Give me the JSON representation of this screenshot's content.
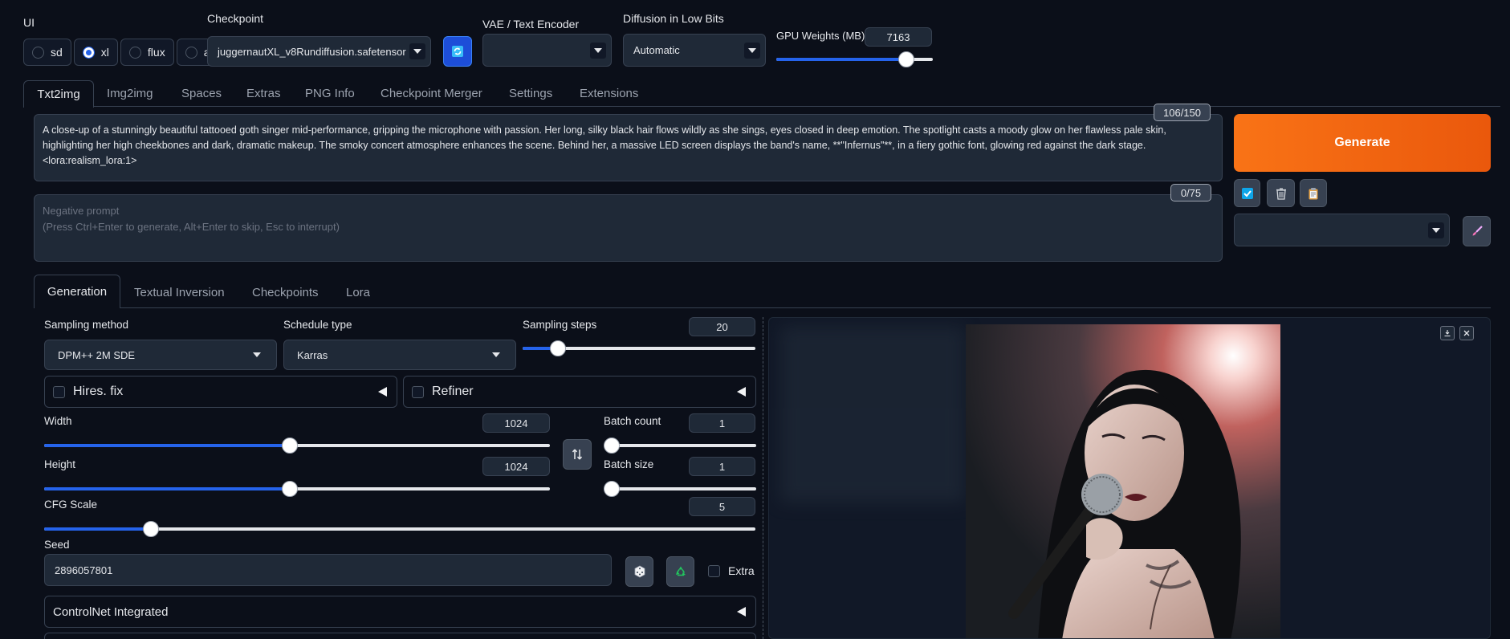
{
  "top": {
    "ui_label": "UI",
    "ui_options": [
      "sd",
      "xl",
      "flux",
      "all"
    ],
    "ui_selected": "xl",
    "checkpoint_label": "Checkpoint",
    "checkpoint_value": "juggernautXL_v8Rundiffusion.safetensor",
    "vae_label": "VAE / Text Encoder",
    "vae_value": "",
    "diffusion_label": "Diffusion in Low Bits",
    "diffusion_value": "Automatic",
    "gpu_label": "GPU Weights (MB)",
    "gpu_value": "7163",
    "gpu_slider_fraction": 0.83
  },
  "tabs": [
    "Txt2img",
    "Img2img",
    "Spaces",
    "Extras",
    "PNG Info",
    "Checkpoint Merger",
    "Settings",
    "Extensions"
  ],
  "prompt": {
    "text": "A close-up of a stunningly beautiful tattooed goth singer mid-performance, gripping the microphone with passion. Her long, silky black hair flows wildly as she sings, eyes closed in deep emotion. The spotlight casts a moody glow on her flawless pale skin, highlighting her high cheekbones and dark, dramatic makeup. The smoky concert atmosphere enhances the scene. Behind her, a massive LED screen displays the band's name, **\"Infernus\"**, in a fiery gothic font, glowing red against the dark stage.  <lora:realism_lora:1>",
    "counter": "106/150",
    "neg_placeholder": "Negative prompt\n(Press Ctrl+Enter to generate, Alt+Enter to skip, Esc to interrupt)",
    "neg_counter": "0/75"
  },
  "generate_label": "Generate",
  "subtabs": [
    "Generation",
    "Textual Inversion",
    "Checkpoints",
    "Lora"
  ],
  "params": {
    "sampling_method_label": "Sampling method",
    "sampling_method": "DPM++ 2M SDE",
    "schedule_label": "Schedule type",
    "schedule": "Karras",
    "steps_label": "Sampling steps",
    "steps": "20",
    "steps_fraction": 0.15,
    "hires_label": "Hires. fix",
    "refiner_label": "Refiner",
    "width_label": "Width",
    "width": "1024",
    "width_fraction": 0.485,
    "height_label": "Height",
    "height": "1024",
    "height_fraction": 0.485,
    "batch_count_label": "Batch count",
    "batch_count": "1",
    "batch_size_label": "Batch size",
    "batch_size": "1",
    "cfg_label": "CFG Scale",
    "cfg": "5",
    "cfg_fraction": 0.15,
    "seed_label": "Seed",
    "seed": "2896057801",
    "extra_label": "Extra",
    "controlnet_label": "ControlNet Integrated"
  },
  "icons": {
    "refresh": "refresh-icon",
    "dice": "dice-icon",
    "recycle": "recycle-icon",
    "swap": "swap-icon",
    "trash": "trash-icon",
    "clipboard": "clipboard-icon",
    "brush": "brush-icon",
    "download": "download-icon",
    "close": "close-icon"
  },
  "colors": {
    "generate": "#ea580c",
    "accent": "#2563eb",
    "background": "#0b0f19"
  }
}
